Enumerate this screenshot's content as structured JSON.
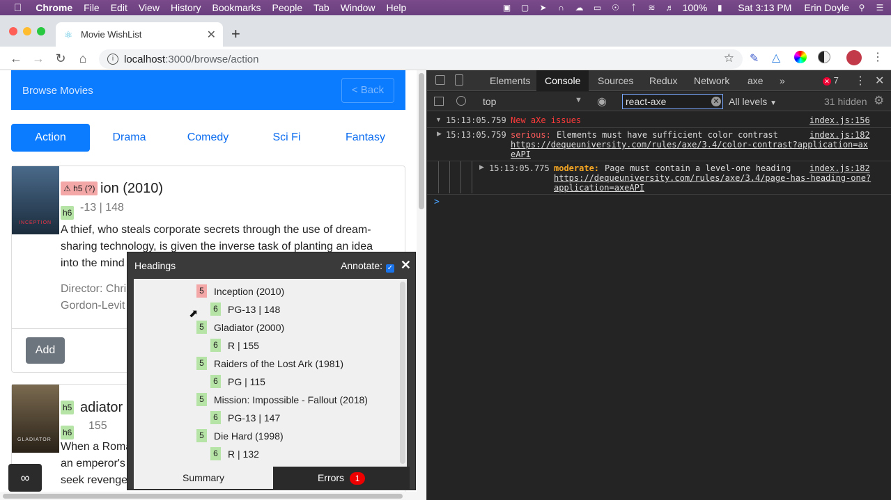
{
  "menubar": {
    "app": "Chrome",
    "items": [
      "File",
      "Edit",
      "View",
      "History",
      "Bookmarks",
      "People",
      "Tab",
      "Window",
      "Help"
    ],
    "battery": "100%",
    "clock": "Sat 3:13 PM",
    "user": "Erin Doyle"
  },
  "browser": {
    "tab_title": "Movie WishList",
    "url_host": "localhost",
    "url_path": ":3000/browse/action"
  },
  "page": {
    "banner_title": "Browse Movies",
    "back_label": "< Back",
    "genres": [
      "Action",
      "Drama",
      "Comedy",
      "Sci Fi",
      "Fantasy"
    ],
    "movie1": {
      "title_visible": "ion (2010)",
      "rating_visible": "-13 | 148",
      "desc_lines": [
        "A thief, who steals corporate secrets through the use of dream-",
        "sharing technology, is given the inverse task of planting an idea",
        "into the mind"
      ],
      "director": "Director: Chri",
      "cast": "Gordon-Levit",
      "add_label": "Add",
      "poster_text": "INCEPTION"
    },
    "movie2": {
      "title_visible": "adiator (",
      "rating_visible": "155",
      "desc_lines": [
        "When a Roma",
        "an emperor's",
        "seek revenge"
      ],
      "poster_text": "GLADIATOR"
    },
    "badges": {
      "h5_warn": "h5 (?)",
      "h6": "h6",
      "h5": "h5"
    }
  },
  "headings_panel": {
    "title": "Headings",
    "annotate_label": "Annotate:",
    "items": [
      {
        "level": "5",
        "text": "Inception (2010)",
        "status": "error"
      },
      {
        "level": "6",
        "text": "PG-13 | 148",
        "status": "ok"
      },
      {
        "level": "5",
        "text": "Gladiator (2000)",
        "status": "ok"
      },
      {
        "level": "6",
        "text": "R | 155",
        "status": "ok"
      },
      {
        "level": "5",
        "text": "Raiders of the Lost Ark (1981)",
        "status": "ok"
      },
      {
        "level": "6",
        "text": "PG | 115",
        "status": "ok"
      },
      {
        "level": "5",
        "text": "Mission: Impossible - Fallout (2018)",
        "status": "ok"
      },
      {
        "level": "6",
        "text": "PG-13 | 147",
        "status": "ok"
      },
      {
        "level": "5",
        "text": "Die Hard (1998)",
        "status": "ok"
      },
      {
        "level": "6",
        "text": "R | 132",
        "status": "ok"
      }
    ],
    "summary_tab": "Summary",
    "errors_tab": "Errors",
    "errors_count": "1"
  },
  "devtools": {
    "tabs": [
      "Elements",
      "Console",
      "Sources",
      "Redux",
      "Network",
      "axe"
    ],
    "active_tab": "Console",
    "more": "»",
    "error_count": "7",
    "context": "top",
    "filter_value": "react-axe",
    "levels": "All levels",
    "hidden": "31 hidden",
    "logs": {
      "l1_time": "15:13:05.759",
      "l1_msg": "New aXe issues",
      "l1_src": "index.js:156",
      "l2_time": "15:13:05.759",
      "l2_kind": "serious:",
      "l2_msg": "Elements must have sufficient color contrast",
      "l2_link1": "https://dequeuniversity.com/rules/axe/3.4/color-contrast?application=ax",
      "l2_link2": "eAPI",
      "l2_src": "index.js:182",
      "l3_time": "15:13:05.775",
      "l3_kind": "moderate:",
      "l3_msg": "Page must contain a level-one heading",
      "l3_link1": "https://dequeuniversity.com/rules/axe/3.4/page-has-heading-one?",
      "l3_link2": "application=axeAPI",
      "l3_src": "index.js:182"
    },
    "prompt": ">"
  }
}
